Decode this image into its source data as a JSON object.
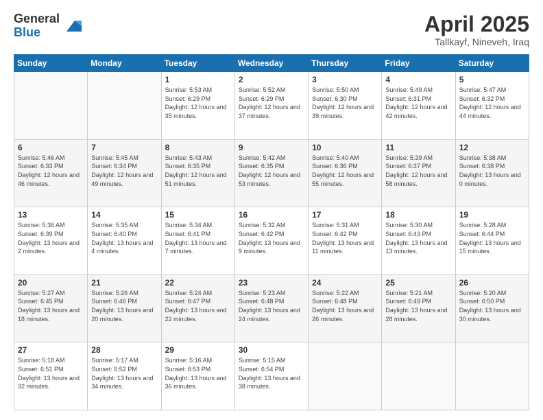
{
  "logo": {
    "general": "General",
    "blue": "Blue"
  },
  "title": "April 2025",
  "subtitle": "Tallkayf, Nineveh, Iraq",
  "days_of_week": [
    "Sunday",
    "Monday",
    "Tuesday",
    "Wednesday",
    "Thursday",
    "Friday",
    "Saturday"
  ],
  "weeks": [
    [
      {
        "num": "",
        "sunrise": "",
        "sunset": "",
        "daylight": "",
        "empty": true
      },
      {
        "num": "",
        "sunrise": "",
        "sunset": "",
        "daylight": "",
        "empty": true
      },
      {
        "num": "1",
        "sunrise": "Sunrise: 5:53 AM",
        "sunset": "Sunset: 6:29 PM",
        "daylight": "Daylight: 12 hours and 35 minutes.",
        "empty": false
      },
      {
        "num": "2",
        "sunrise": "Sunrise: 5:52 AM",
        "sunset": "Sunset: 6:29 PM",
        "daylight": "Daylight: 12 hours and 37 minutes.",
        "empty": false
      },
      {
        "num": "3",
        "sunrise": "Sunrise: 5:50 AM",
        "sunset": "Sunset: 6:30 PM",
        "daylight": "Daylight: 12 hours and 39 minutes.",
        "empty": false
      },
      {
        "num": "4",
        "sunrise": "Sunrise: 5:49 AM",
        "sunset": "Sunset: 6:31 PM",
        "daylight": "Daylight: 12 hours and 42 minutes.",
        "empty": false
      },
      {
        "num": "5",
        "sunrise": "Sunrise: 5:47 AM",
        "sunset": "Sunset: 6:32 PM",
        "daylight": "Daylight: 12 hours and 44 minutes.",
        "empty": false
      }
    ],
    [
      {
        "num": "6",
        "sunrise": "Sunrise: 5:46 AM",
        "sunset": "Sunset: 6:33 PM",
        "daylight": "Daylight: 12 hours and 46 minutes.",
        "empty": false
      },
      {
        "num": "7",
        "sunrise": "Sunrise: 5:45 AM",
        "sunset": "Sunset: 6:34 PM",
        "daylight": "Daylight: 12 hours and 49 minutes.",
        "empty": false
      },
      {
        "num": "8",
        "sunrise": "Sunrise: 5:43 AM",
        "sunset": "Sunset: 6:35 PM",
        "daylight": "Daylight: 12 hours and 51 minutes.",
        "empty": false
      },
      {
        "num": "9",
        "sunrise": "Sunrise: 5:42 AM",
        "sunset": "Sunset: 6:35 PM",
        "daylight": "Daylight: 12 hours and 53 minutes.",
        "empty": false
      },
      {
        "num": "10",
        "sunrise": "Sunrise: 5:40 AM",
        "sunset": "Sunset: 6:36 PM",
        "daylight": "Daylight: 12 hours and 55 minutes.",
        "empty": false
      },
      {
        "num": "11",
        "sunrise": "Sunrise: 5:39 AM",
        "sunset": "Sunset: 6:37 PM",
        "daylight": "Daylight: 12 hours and 58 minutes.",
        "empty": false
      },
      {
        "num": "12",
        "sunrise": "Sunrise: 5:38 AM",
        "sunset": "Sunset: 6:38 PM",
        "daylight": "Daylight: 13 hours and 0 minutes.",
        "empty": false
      }
    ],
    [
      {
        "num": "13",
        "sunrise": "Sunrise: 5:36 AM",
        "sunset": "Sunset: 6:39 PM",
        "daylight": "Daylight: 13 hours and 2 minutes.",
        "empty": false
      },
      {
        "num": "14",
        "sunrise": "Sunrise: 5:35 AM",
        "sunset": "Sunset: 6:40 PM",
        "daylight": "Daylight: 13 hours and 4 minutes.",
        "empty": false
      },
      {
        "num": "15",
        "sunrise": "Sunrise: 5:34 AM",
        "sunset": "Sunset: 6:41 PM",
        "daylight": "Daylight: 13 hours and 7 minutes.",
        "empty": false
      },
      {
        "num": "16",
        "sunrise": "Sunrise: 5:32 AM",
        "sunset": "Sunset: 6:42 PM",
        "daylight": "Daylight: 13 hours and 9 minutes.",
        "empty": false
      },
      {
        "num": "17",
        "sunrise": "Sunrise: 5:31 AM",
        "sunset": "Sunset: 6:42 PM",
        "daylight": "Daylight: 13 hours and 11 minutes.",
        "empty": false
      },
      {
        "num": "18",
        "sunrise": "Sunrise: 5:30 AM",
        "sunset": "Sunset: 6:43 PM",
        "daylight": "Daylight: 13 hours and 13 minutes.",
        "empty": false
      },
      {
        "num": "19",
        "sunrise": "Sunrise: 5:28 AM",
        "sunset": "Sunset: 6:44 PM",
        "daylight": "Daylight: 13 hours and 15 minutes.",
        "empty": false
      }
    ],
    [
      {
        "num": "20",
        "sunrise": "Sunrise: 5:27 AM",
        "sunset": "Sunset: 6:45 PM",
        "daylight": "Daylight: 13 hours and 18 minutes.",
        "empty": false
      },
      {
        "num": "21",
        "sunrise": "Sunrise: 5:26 AM",
        "sunset": "Sunset: 6:46 PM",
        "daylight": "Daylight: 13 hours and 20 minutes.",
        "empty": false
      },
      {
        "num": "22",
        "sunrise": "Sunrise: 5:24 AM",
        "sunset": "Sunset: 6:47 PM",
        "daylight": "Daylight: 13 hours and 22 minutes.",
        "empty": false
      },
      {
        "num": "23",
        "sunrise": "Sunrise: 5:23 AM",
        "sunset": "Sunset: 6:48 PM",
        "daylight": "Daylight: 13 hours and 24 minutes.",
        "empty": false
      },
      {
        "num": "24",
        "sunrise": "Sunrise: 5:22 AM",
        "sunset": "Sunset: 6:48 PM",
        "daylight": "Daylight: 13 hours and 26 minutes.",
        "empty": false
      },
      {
        "num": "25",
        "sunrise": "Sunrise: 5:21 AM",
        "sunset": "Sunset: 6:49 PM",
        "daylight": "Daylight: 13 hours and 28 minutes.",
        "empty": false
      },
      {
        "num": "26",
        "sunrise": "Sunrise: 5:20 AM",
        "sunset": "Sunset: 6:50 PM",
        "daylight": "Daylight: 13 hours and 30 minutes.",
        "empty": false
      }
    ],
    [
      {
        "num": "27",
        "sunrise": "Sunrise: 5:18 AM",
        "sunset": "Sunset: 6:51 PM",
        "daylight": "Daylight: 13 hours and 32 minutes.",
        "empty": false
      },
      {
        "num": "28",
        "sunrise": "Sunrise: 5:17 AM",
        "sunset": "Sunset: 6:52 PM",
        "daylight": "Daylight: 13 hours and 34 minutes.",
        "empty": false
      },
      {
        "num": "29",
        "sunrise": "Sunrise: 5:16 AM",
        "sunset": "Sunset: 6:53 PM",
        "daylight": "Daylight: 13 hours and 36 minutes.",
        "empty": false
      },
      {
        "num": "30",
        "sunrise": "Sunrise: 5:15 AM",
        "sunset": "Sunset: 6:54 PM",
        "daylight": "Daylight: 13 hours and 38 minutes.",
        "empty": false
      },
      {
        "num": "",
        "sunrise": "",
        "sunset": "",
        "daylight": "",
        "empty": true
      },
      {
        "num": "",
        "sunrise": "",
        "sunset": "",
        "daylight": "",
        "empty": true
      },
      {
        "num": "",
        "sunrise": "",
        "sunset": "",
        "daylight": "",
        "empty": true
      }
    ]
  ]
}
